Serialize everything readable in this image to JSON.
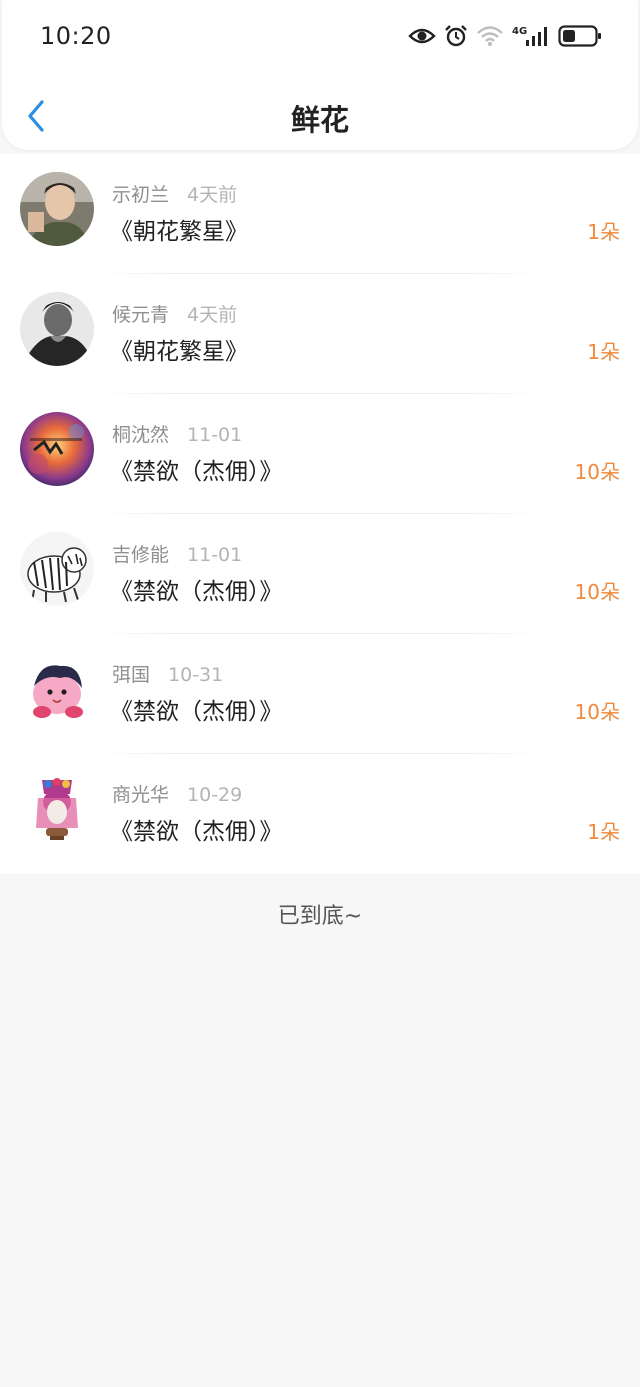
{
  "status_bar": {
    "time": "10:20",
    "network_label": "4G",
    "icons": [
      "eye-icon",
      "alarm-icon",
      "wifi-icon",
      "signal-icon",
      "battery-icon"
    ]
  },
  "nav": {
    "title": "鲜花",
    "back_icon": "chevron-left-icon"
  },
  "gifts": [
    {
      "name": "示初兰",
      "time": "4天前",
      "work": "《朝花繁星》",
      "count": "1朵"
    },
    {
      "name": "候元青",
      "time": "4天前",
      "work": "《朝花繁星》",
      "count": "1朵"
    },
    {
      "name": "桐沈然",
      "time": "11-01",
      "work": "《禁欲（杰佣）》",
      "count": "10朵"
    },
    {
      "name": "吉修能",
      "time": "11-01",
      "work": "《禁欲（杰佣）》",
      "count": "10朵"
    },
    {
      "name": "弭国",
      "time": "10-31",
      "work": "《禁欲（杰佣）》",
      "count": "10朵"
    },
    {
      "name": "商光华",
      "time": "10-29",
      "work": "《禁欲（杰佣）》",
      "count": "1朵"
    }
  ],
  "footer": {
    "end_text": "已到底~"
  },
  "colors": {
    "accent_blue": "#2a8ee8",
    "count_orange": "#f08a3c",
    "background": "#f8f7f8"
  }
}
